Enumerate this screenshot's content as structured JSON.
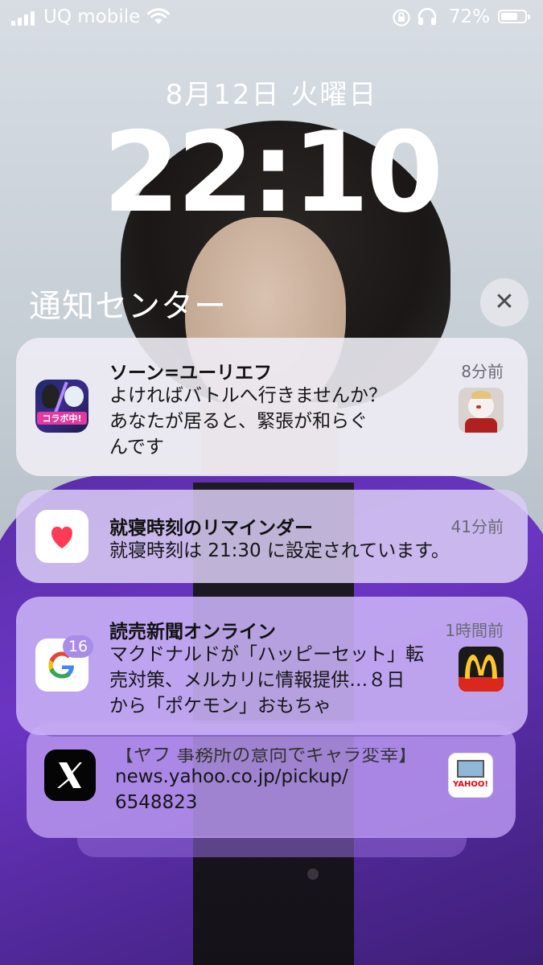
{
  "status_bar": {
    "carrier": "UQ mobile",
    "battery_percent": "72%",
    "battery_level": 0.72,
    "icons": [
      "signal-icon",
      "wifi-icon",
      "rotation-lock-icon",
      "headphones-icon",
      "battery-icon"
    ]
  },
  "lock_screen": {
    "date": "8月12日 火曜日",
    "time": "22:10"
  },
  "notification_center": {
    "title": "通知センター",
    "close_icon": "close-icon"
  },
  "notifications": [
    {
      "app_icon": "game-app-icon",
      "title": "ソーン=ユーリエフ",
      "time": "8分前",
      "body_lines": [
        "よければバトルへ行きませんか？",
        "あなたが居ると、緊張が和らぐ",
        "んです"
      ],
      "app_icon_badge_text": "コラボ中!"
    },
    {
      "app_icon": "health-heart-icon",
      "title": "就寝時刻のリマインダー",
      "time": "41分前",
      "body_lines": [
        "就寝時刻は 21:30 に設定されています。"
      ]
    },
    {
      "app_icon": "google-icon",
      "badge": "16",
      "title": "読売新聞オンライン",
      "time": "1時間前",
      "body_lines": [
        "マクドナルドが「ハッピーセット」転",
        "売対策、メルカリに情報提供…８日",
        "から「ポケモン」おもちゃ"
      ],
      "thumb": "mcdonalds-logo-thumb"
    },
    {
      "app_icon": "x-app-icon",
      "body_lines": [
        "【ヤフ 事務所の意向でギャラ変幸】",
        "news.yahoo.co.jp/pickup/",
        "6548823"
      ],
      "thumb": "yahoo-news-thumb",
      "thumb_text": "YAHOO!"
    }
  ],
  "colors": {
    "jacket": "#6b35c3",
    "heart": "#ff3b55",
    "mcdonalds_yellow": "#ffc72c",
    "mcdonalds_red": "#da291c"
  }
}
